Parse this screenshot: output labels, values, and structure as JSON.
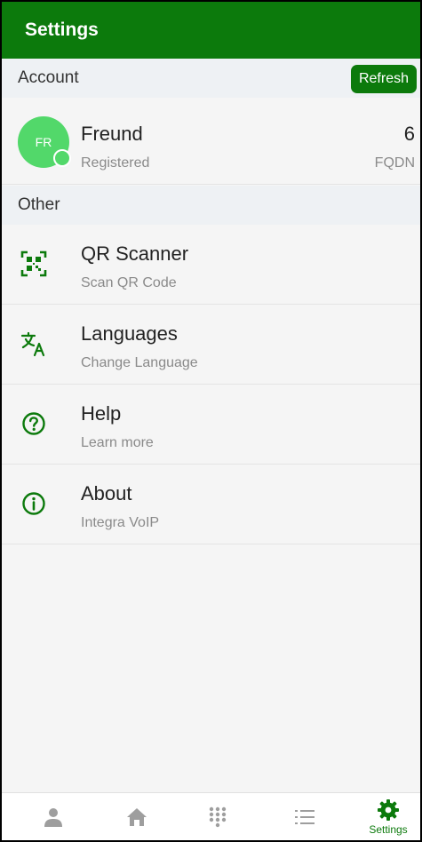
{
  "app": {
    "title": "Settings"
  },
  "account_section": {
    "header": "Account",
    "refresh_label": "Refresh",
    "account": {
      "initials": "FR",
      "name": "Freund",
      "status": "Registered",
      "number": "6",
      "type": "FQDN"
    }
  },
  "other_section": {
    "header": "Other",
    "items": [
      {
        "icon": "qr-scanner-icon",
        "title": "QR Scanner",
        "subtitle": "Scan QR Code"
      },
      {
        "icon": "translate-icon",
        "title": "Languages",
        "subtitle": "Change Language"
      },
      {
        "icon": "help-icon",
        "title": "Help",
        "subtitle": "Learn more"
      },
      {
        "icon": "info-icon",
        "title": "About",
        "subtitle": "Integra VoIP"
      }
    ]
  },
  "bottom_nav": {
    "items": [
      {
        "icon": "person-icon"
      },
      {
        "icon": "home-icon"
      },
      {
        "icon": "dialpad-icon"
      },
      {
        "icon": "list-icon"
      },
      {
        "icon": "gear-icon",
        "label": "Settings",
        "active": true
      }
    ]
  },
  "colors": {
    "brand": "#0c7a0c",
    "avatar": "#52d86a",
    "header_bg": "#eef1f4",
    "inactive_icon": "#9e9e9e"
  }
}
